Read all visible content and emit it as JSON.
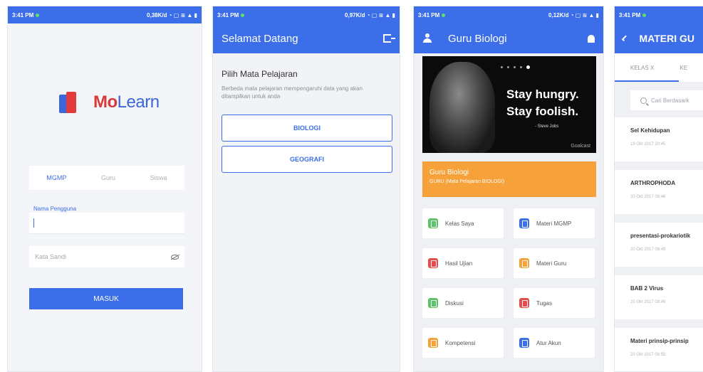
{
  "status_time": "3:41 PM",
  "screens": {
    "login": {
      "status_right": "0,38K/d ◔ ▢ ≋ ▲ ▮",
      "logo_mo": "Mo",
      "logo_learn": "Learn",
      "roles": [
        "MGMP",
        "Guru",
        "Siswa"
      ],
      "username_label": "Nama Pengguna",
      "password_placeholder": "Kata Sandi",
      "submit_label": "MASUK"
    },
    "subject": {
      "status_right": "0,97K/d ◔ ▢ ≋ ▲ ▮",
      "title": "Selamat Datang",
      "heading": "Pilih Mata Pelajaran",
      "description": "Berbeda mata pelajaran mempengaruhi data yang akan ditampilkan untuk anda",
      "subjects": [
        "BIOLOGI",
        "GEOGRAFI"
      ]
    },
    "home": {
      "status_right": "0,12K/d ◔ ▢ ≋ ▲ ▮",
      "title": "Guru Biologi",
      "banner_line1": "Stay hungry.",
      "banner_line2": "Stay foolish.",
      "banner_author": "- Steve Jobs",
      "banner_brand": "Goalcast",
      "card_title": "Guru Biologi",
      "card_subtitle": "GURU (Mata Pelajaran BIOLOGI)",
      "menu": [
        {
          "label": "Kelas Saya",
          "color": "#5cc36b"
        },
        {
          "label": "Materi MGMP",
          "color": "#3b6ee8"
        },
        {
          "label": "Hasil Ujian",
          "color": "#e84b4b"
        },
        {
          "label": "Materi Guru",
          "color": "#f6a13a"
        },
        {
          "label": "Diskusi",
          "color": "#5cc36b"
        },
        {
          "label": "Tugas",
          "color": "#e84b4b"
        },
        {
          "label": "Kompetensi",
          "color": "#f6a13a"
        },
        {
          "label": "Atur Akun",
          "color": "#3b6ee8"
        }
      ]
    },
    "materials": {
      "title": "MATERI GU",
      "tabs": [
        "KELAS X",
        "KE"
      ],
      "search_placeholder": "Cari Berdasark",
      "items": [
        {
          "name": "Sel Kehidupan",
          "date": "19 Okt 2017 20:45"
        },
        {
          "name": "ARTHROPHODA",
          "date": "20 Okt 2017 08:46"
        },
        {
          "name": "presentasi-prokariotik",
          "date": "20 Okt 2017 08:49"
        },
        {
          "name": "BAB 2 Virus",
          "date": "20 Okt 2017 08:49"
        },
        {
          "name": "Materi prinsip-prinsip",
          "date": "20 Okt 2017 08:55"
        }
      ]
    }
  }
}
